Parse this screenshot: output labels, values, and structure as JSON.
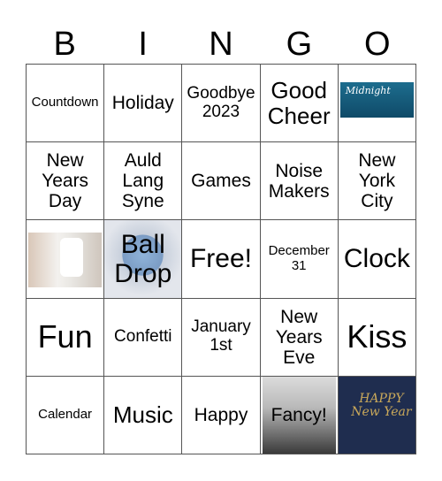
{
  "header": [
    "B",
    "I",
    "N",
    "G",
    "O"
  ],
  "cells": [
    {
      "text": "Countdown",
      "size": "s15"
    },
    {
      "text": "Holiday",
      "size": "s21"
    },
    {
      "text": "Goodbye 2023",
      "size": "s19"
    },
    {
      "text": "Good Cheer",
      "size": "s26"
    },
    {
      "text": "",
      "image": "midnight-image",
      "caption": "Midnight"
    },
    {
      "text": "New Years Day",
      "size": "s21"
    },
    {
      "text": "Auld Lang Syne",
      "size": "s21"
    },
    {
      "text": "Games",
      "size": "s21"
    },
    {
      "text": "Noise Makers",
      "size": "s21"
    },
    {
      "text": "New York City",
      "size": "s21"
    },
    {
      "text": "",
      "image": "baby-onesie-image"
    },
    {
      "text": "Ball Drop",
      "size": "s30",
      "image": "ball-drop-image"
    },
    {
      "text": "Free!",
      "size": "s30"
    },
    {
      "text": "December 31",
      "size": "s15"
    },
    {
      "text": "Clock",
      "size": "s30"
    },
    {
      "text": "Fun",
      "size": "s36"
    },
    {
      "text": "Confetti",
      "size": "s19"
    },
    {
      "text": "January 1st",
      "size": "s19"
    },
    {
      "text": "New Years Eve",
      "size": "s21"
    },
    {
      "text": "Kiss",
      "size": "s36"
    },
    {
      "text": "Calendar",
      "size": "s15"
    },
    {
      "text": "Music",
      "size": "s26"
    },
    {
      "text": "Happy",
      "size": "s21"
    },
    {
      "text": "Fancy!",
      "size": "s21",
      "image": "party-people-image"
    },
    {
      "text": "",
      "image": "happy-new-year-image",
      "caption": "HAPPY New Year"
    }
  ]
}
